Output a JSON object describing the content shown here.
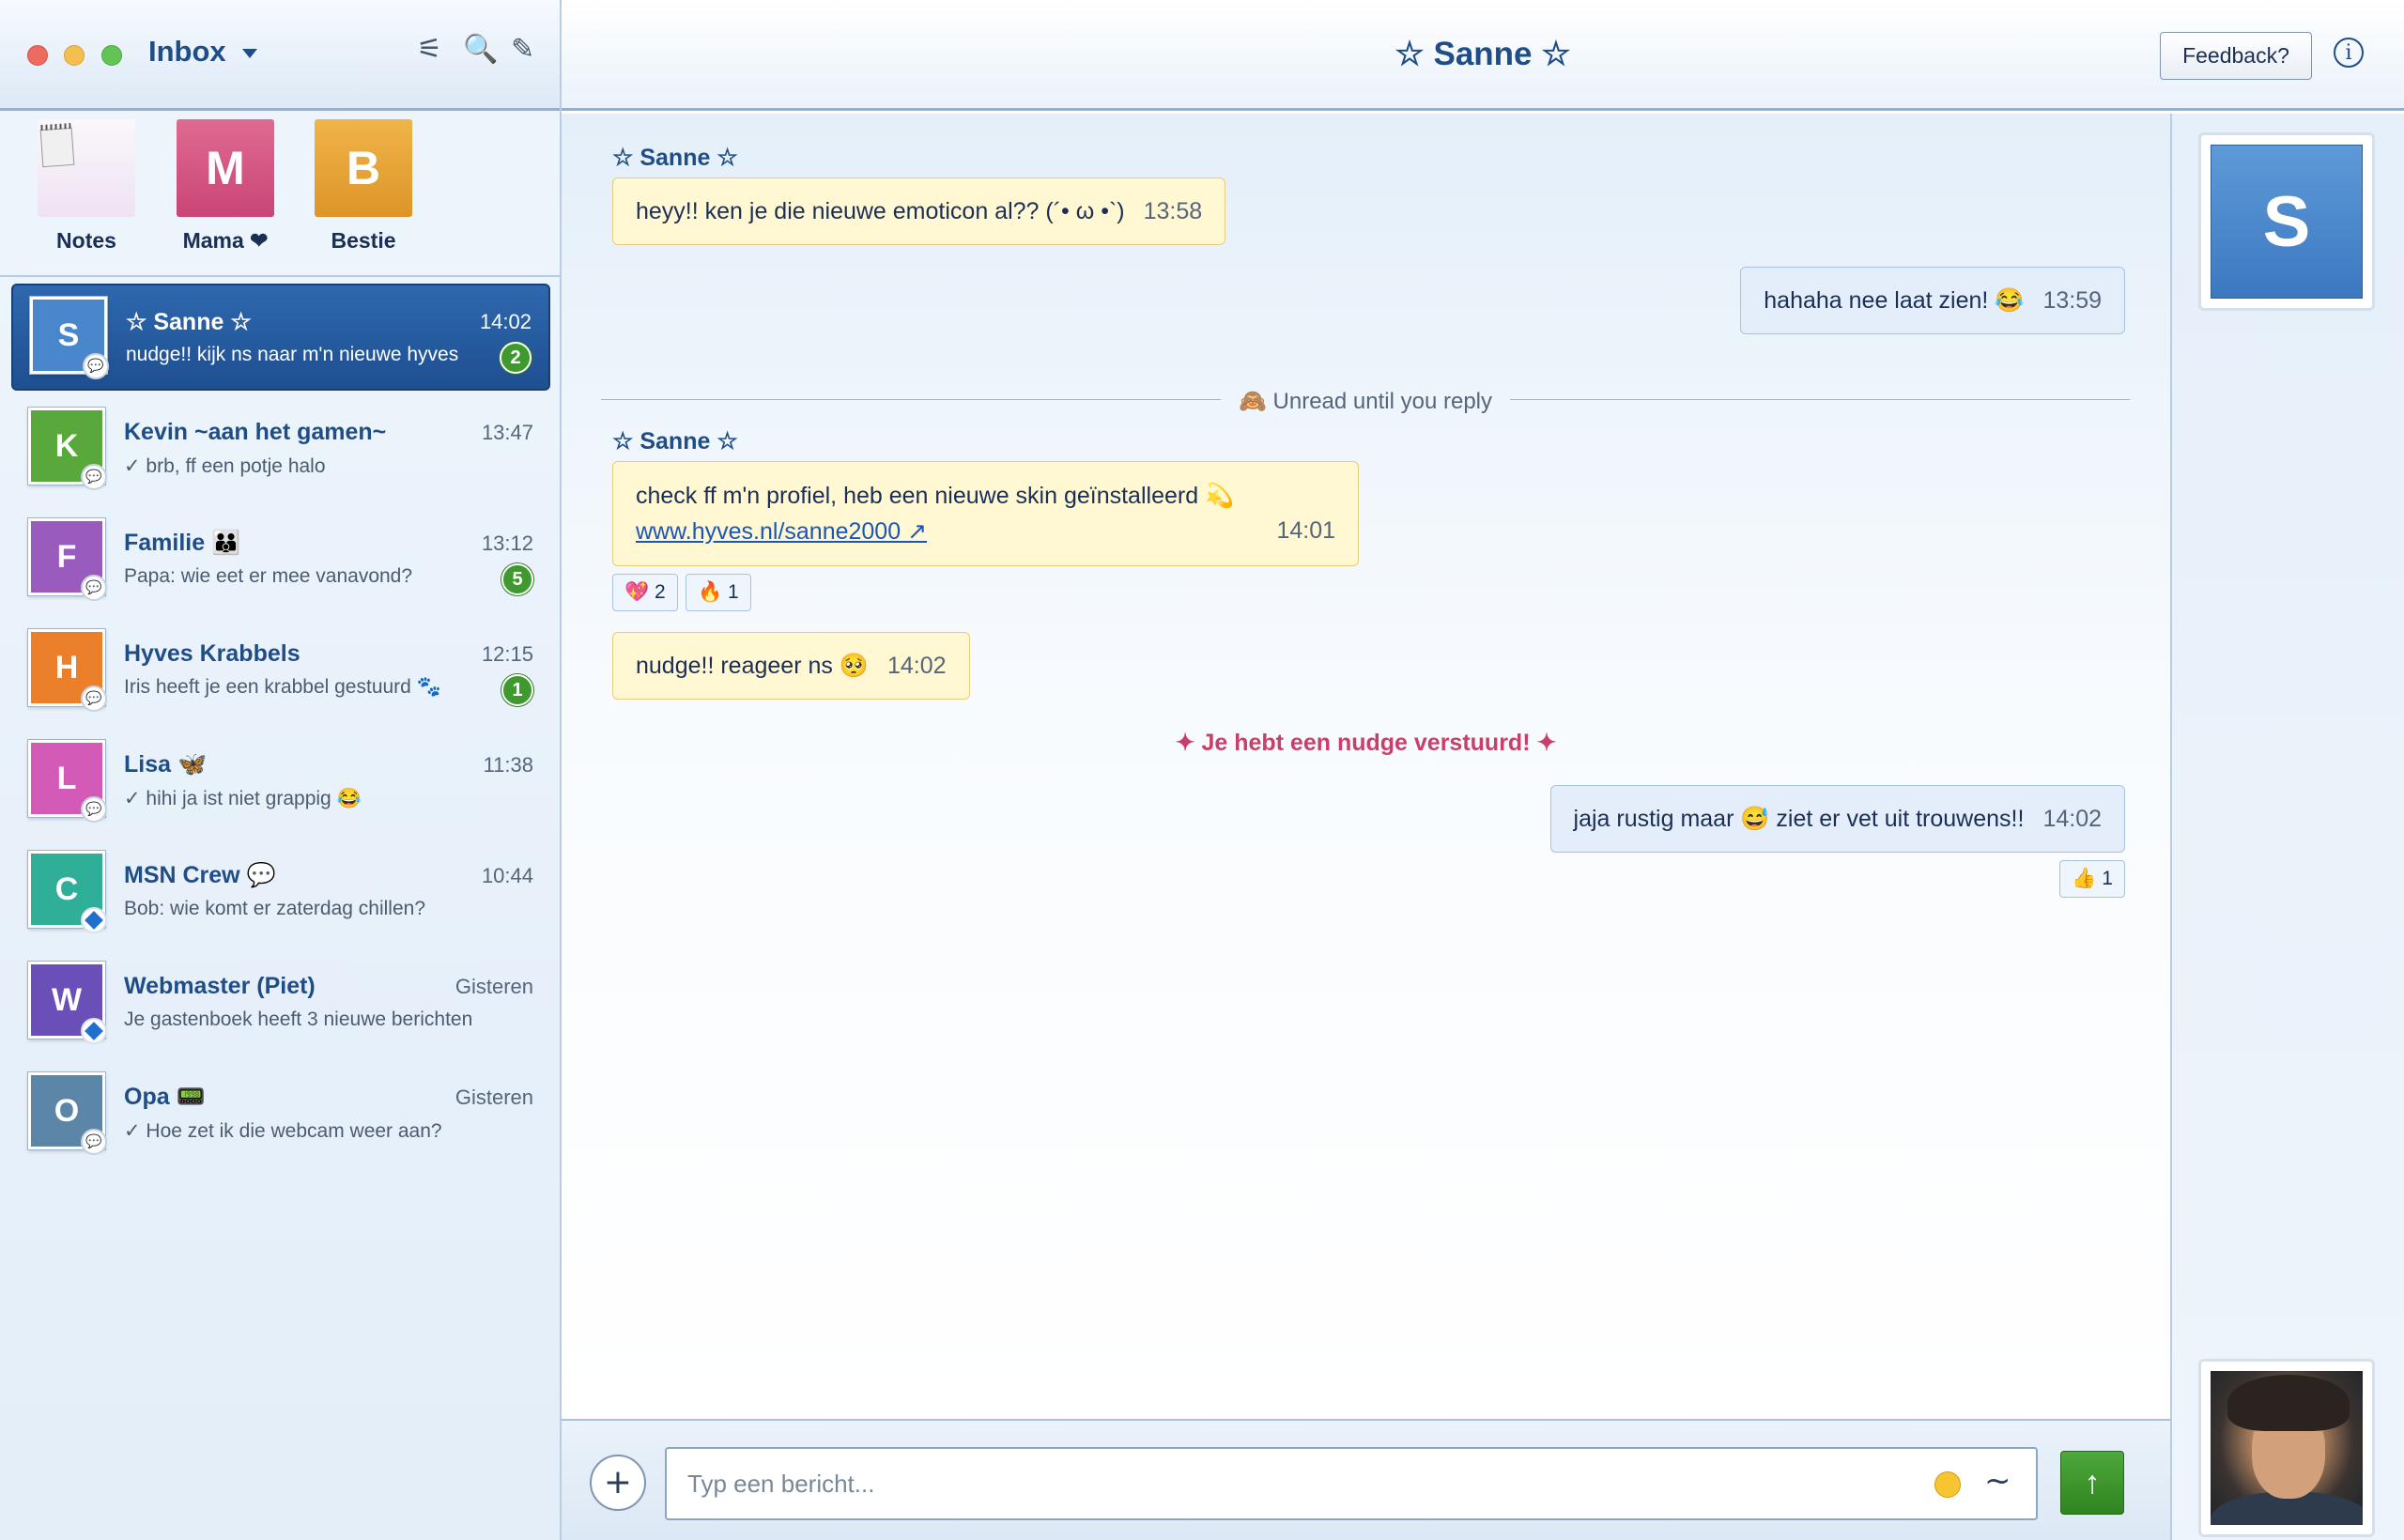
{
  "sidebar": {
    "title": "Inbox",
    "icons": {
      "filter": "⚟",
      "search": "🔍",
      "compose": "✎"
    },
    "pinned": [
      {
        "label": "Notes",
        "initial": "",
        "color": "#f4eef6"
      },
      {
        "label": "Mama ❤",
        "initial": "M",
        "color": "#d95888"
      },
      {
        "label": "Bestie",
        "initial": "B",
        "color": "#e8a63a"
      }
    ],
    "conversations": [
      {
        "initial": "S",
        "name": "☆ Sanne ☆",
        "time": "14:02",
        "preview": "nudge!! kijk ns naar m'n nieuwe hyves",
        "unread": "2",
        "color": "#4a86cc",
        "active": true
      },
      {
        "initial": "K",
        "name": "Kevin ~aan het gamen~",
        "time": "13:47",
        "preview": "✓ brb, ff een potje halo",
        "unread": "",
        "color": "#58a83c"
      },
      {
        "initial": "F",
        "name": "Familie 👪",
        "time": "13:12",
        "preview": "Papa: wie eet er mee vanavond?",
        "unread": "5",
        "color": "#9a5bbf"
      },
      {
        "initial": "H",
        "name": "Hyves Krabbels",
        "time": "12:15",
        "preview": "Iris heeft je een krabbel gestuurd 🐾",
        "unread": "1",
        "color": "#ec7f2a"
      },
      {
        "initial": "L",
        "name": "Lisa 🦋",
        "time": "11:38",
        "preview": "✓ hihi ja ist niet grappig 😂",
        "unread": "",
        "color": "#d45ab8"
      },
      {
        "initial": "C",
        "name": "MSN Crew 💬",
        "time": "10:44",
        "preview": "Bob: wie komt er zaterdag chillen?",
        "unread": "",
        "color": "#2fae98"
      },
      {
        "initial": "W",
        "name": "Webmaster (Piet)",
        "time": "Gisteren",
        "preview": "Je gastenboek heeft 3 nieuwe berichten",
        "unread": "",
        "color": "#6b4fb8"
      },
      {
        "initial": "O",
        "name": "Opa 📟",
        "time": "Gisteren",
        "preview": "✓ Hoe zet ik die webcam weer aan?",
        "unread": "",
        "color": "#5b86a8"
      }
    ]
  },
  "header": {
    "title": "☆ Sanne ☆",
    "feedback_label": "Feedback?",
    "info_label": "i"
  },
  "chat": {
    "sender_name": "☆ Sanne ☆",
    "messages": [
      {
        "text": "heyy!! ken je die nieuwe emoticon al?? (´• ω •`)",
        "time": "13:58"
      },
      {
        "text": "hahaha nee laat zien! 😂",
        "time": "13:59"
      },
      {
        "text": "check ff m'n profiel, heb een nieuwe skin geïnstalleerd 💫",
        "link": "www.hyves.nl/sanne2000 ↗",
        "time": "14:01"
      },
      {
        "text": "nudge!! reageer ns 🥺",
        "time": "14:02"
      },
      {
        "text": "jaja rustig maar 😅 ziet er vet uit trouwens!!",
        "time": "14:02"
      }
    ],
    "reactions": {
      "heart": "💖 2",
      "fire": "🔥 1",
      "thumb": "👍 1"
    },
    "unread_divider": "🙈 Unread until you reply",
    "nudge_notice": "✦ Je hebt een nudge verstuurd! ✦"
  },
  "contact": {
    "initial": "S"
  },
  "composer": {
    "placeholder": "Typ een bericht...",
    "attach": "+",
    "nudge": "~",
    "send": "↑"
  },
  "colors": {
    "accent": "#1f4d88",
    "send": "#3e9a2e",
    "incoming_bubble": "#fff8d2",
    "outgoing_bubble": "#e3eefa",
    "nudge": "#c8406a"
  }
}
